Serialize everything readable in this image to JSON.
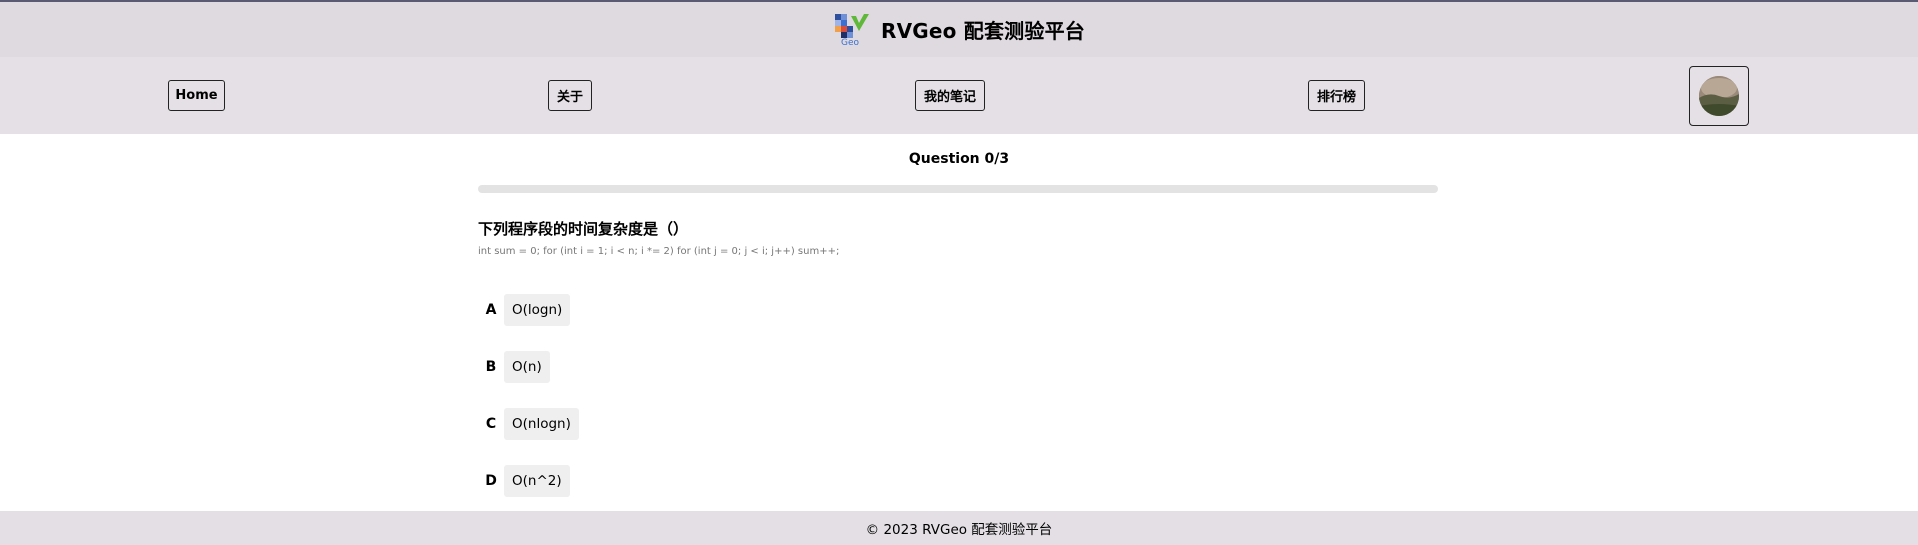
{
  "header": {
    "logo_text": "Geo",
    "title": "RVGeo 配套测验平台"
  },
  "nav": {
    "items": [
      {
        "label": "Home"
      },
      {
        "label": "关于"
      },
      {
        "label": "我的笔记"
      },
      {
        "label": "排行榜"
      }
    ],
    "avatar": "user-avatar"
  },
  "quiz": {
    "counter": "Question 0/3",
    "progress": 0,
    "question": "下列程序段的时间复杂度是（）",
    "code": "int sum = 0; for (int i = 1; i < n; i *= 2) for (int j = 0; j < i; j++) sum++;",
    "options": [
      {
        "letter": "A",
        "text": "O(logn)"
      },
      {
        "letter": "B",
        "text": "O(n)"
      },
      {
        "letter": "C",
        "text": "O(nlogn)"
      },
      {
        "letter": "D",
        "text": "O(n^2)"
      }
    ]
  },
  "footer": {
    "text": "© 2023 RVGeo 配套测验平台"
  },
  "colors": {
    "header_bg": "#dfdae0",
    "nav_bg": "#e4e0e6",
    "footer_bg": "#e3dfe5",
    "option_bg": "#efefef",
    "logo_blue": "#3b6fd0",
    "logo_green": "#5fb83a"
  }
}
